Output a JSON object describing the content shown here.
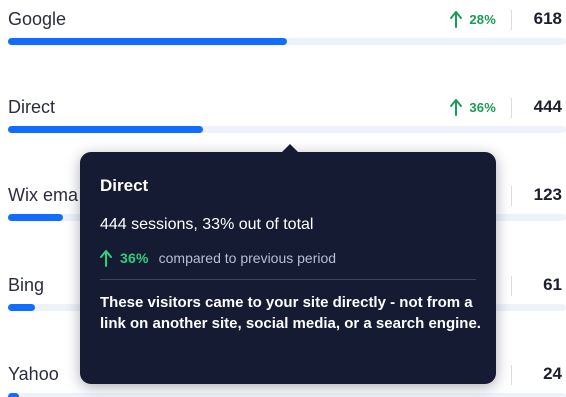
{
  "sources": [
    {
      "name": "Google",
      "change": "28%",
      "value": "618",
      "share": 0.5
    },
    {
      "name": "Direct",
      "change": "36%",
      "value": "444",
      "share": 0.35
    },
    {
      "name": "Wix ema",
      "change": "",
      "value": "123",
      "share": 0.098
    },
    {
      "name": "Bing",
      "change": "",
      "value": "61",
      "share": 0.048
    },
    {
      "name": "Yahoo",
      "change": "",
      "value": "24",
      "share": 0.02
    }
  ],
  "tooltip": {
    "title": "Direct",
    "stats": "444 sessions, 33% out of total",
    "change": "36%",
    "compare_text": "compared to previous period",
    "description": "These visitors came to your site directly - not from a link on another site, social media, or a search engine."
  },
  "colors": {
    "bar": "#116dff",
    "track": "#eef2fb",
    "positive_change": "#1c9b55",
    "tooltip_background": "#151b32",
    "tooltip_positive_change": "#2fcf7a"
  },
  "icons": {
    "change": "arrow-up-icon"
  }
}
